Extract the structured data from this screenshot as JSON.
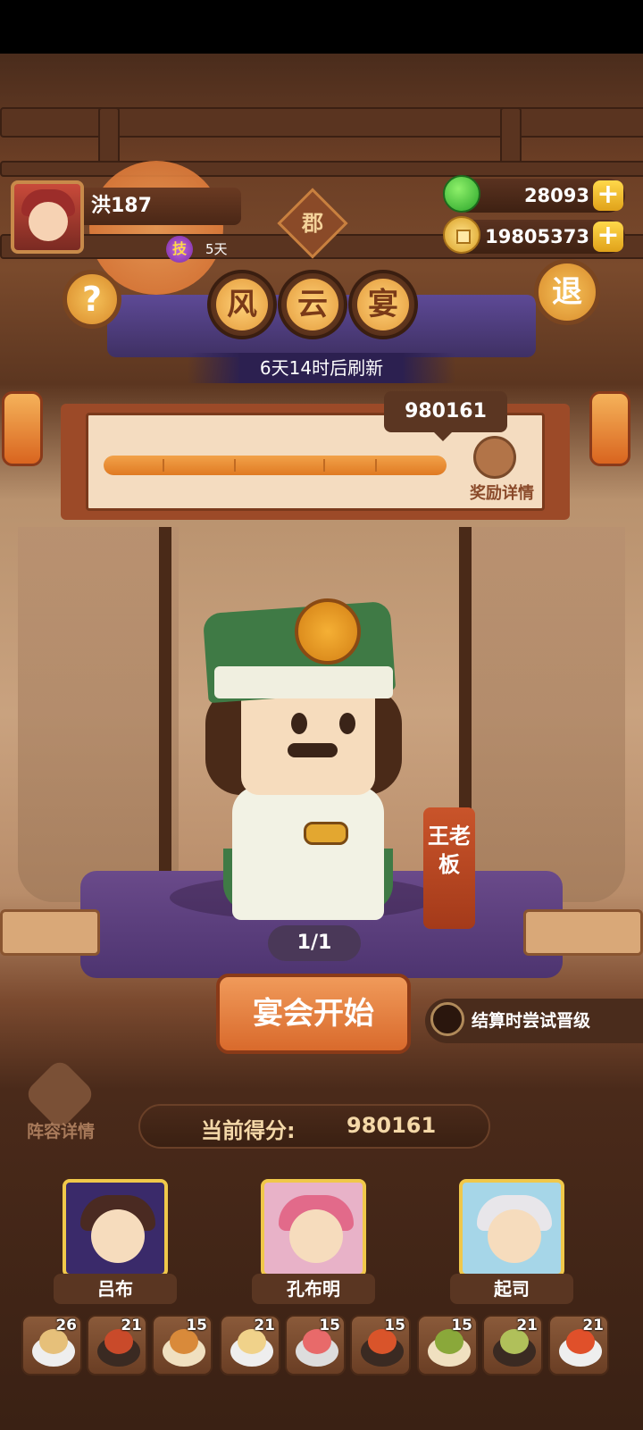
{
  "player": {
    "name": "洪187",
    "skill_badge": "技",
    "skill_days": "5天"
  },
  "county_label": "郡",
  "currency": {
    "jade": "28093",
    "coins": "19805373",
    "plus": "+"
  },
  "buttons": {
    "help": "?",
    "exit": "退"
  },
  "title_chars": [
    "风",
    "云",
    "宴"
  ],
  "refresh_text": "6天14时后刷新",
  "progress": {
    "score_bubble": "980161",
    "reward_label": "奖励详情",
    "fill_fraction": 1.0
  },
  "boss_name": "王老板",
  "page_indicator": "1/1",
  "start_button": "宴会开始",
  "auto_upgrade_label": "结算时尝试晋级",
  "lineup_label": "阵容详情",
  "current_score": {
    "label": "当前得分:",
    "value": "980161"
  },
  "heroes": [
    {
      "name": "吕布",
      "bg": "#3a2a6a",
      "hair": "#4a2a22"
    },
    {
      "name": "孔布明",
      "bg": "#e8b2c8",
      "hair": "#e26a8a"
    },
    {
      "name": "起司",
      "bg": "#a6d6e8",
      "hair": "#e8e6ea"
    }
  ],
  "dishes": [
    {
      "count": "26",
      "color": "#e6c07a"
    },
    {
      "count": "21",
      "color": "#c94a2a"
    },
    {
      "count": "15",
      "color": "#d98a3a"
    },
    {
      "count": "21",
      "color": "#f0d28a"
    },
    {
      "count": "15",
      "color": "#e86a6a"
    },
    {
      "count": "15",
      "color": "#d9542a"
    },
    {
      "count": "15",
      "color": "#8aa83a"
    },
    {
      "count": "21",
      "color": "#b0c05a"
    },
    {
      "count": "21",
      "color": "#e0502a"
    }
  ],
  "colors": {
    "accent_orange": "#d96a2c",
    "gold": "#f0c84a",
    "panel_brown": "#4a2c1c"
  }
}
